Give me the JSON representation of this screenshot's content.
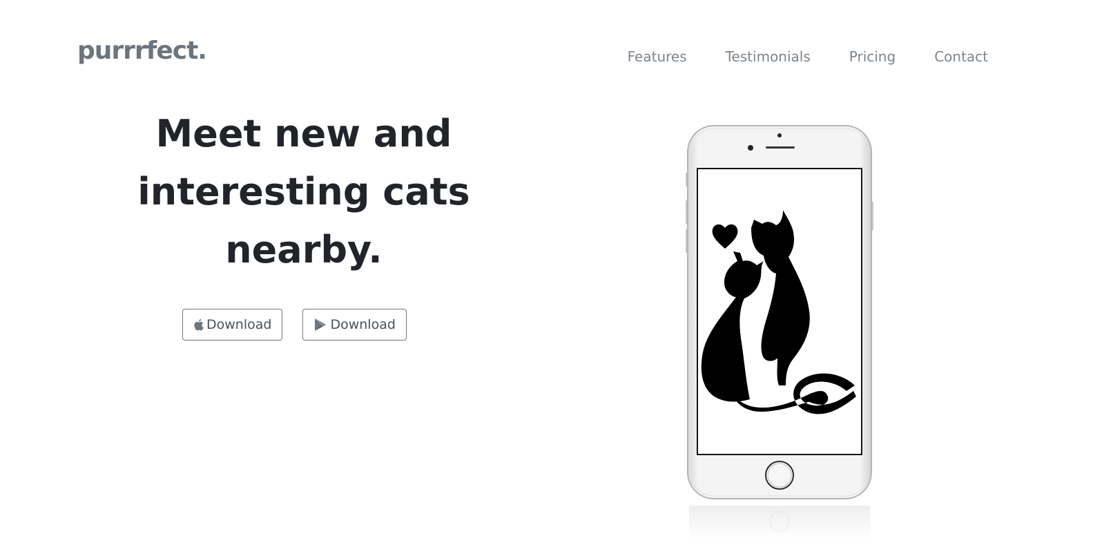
{
  "brand": {
    "name": "purrrfect."
  },
  "nav": {
    "items": [
      {
        "label": "Features"
      },
      {
        "label": "Testimonials"
      },
      {
        "label": "Pricing"
      },
      {
        "label": "Contact"
      }
    ]
  },
  "hero": {
    "title_lines": [
      "Meet new and",
      "interesting cats",
      "nearby."
    ],
    "buttons": [
      {
        "label": "Download",
        "icon": "apple-icon"
      },
      {
        "label": "Download",
        "icon": "google-play-icon"
      }
    ]
  },
  "colors": {
    "brand": "#6c757d",
    "heading": "#212529",
    "nav": "#7d858c",
    "button_border": "#6c757d"
  }
}
